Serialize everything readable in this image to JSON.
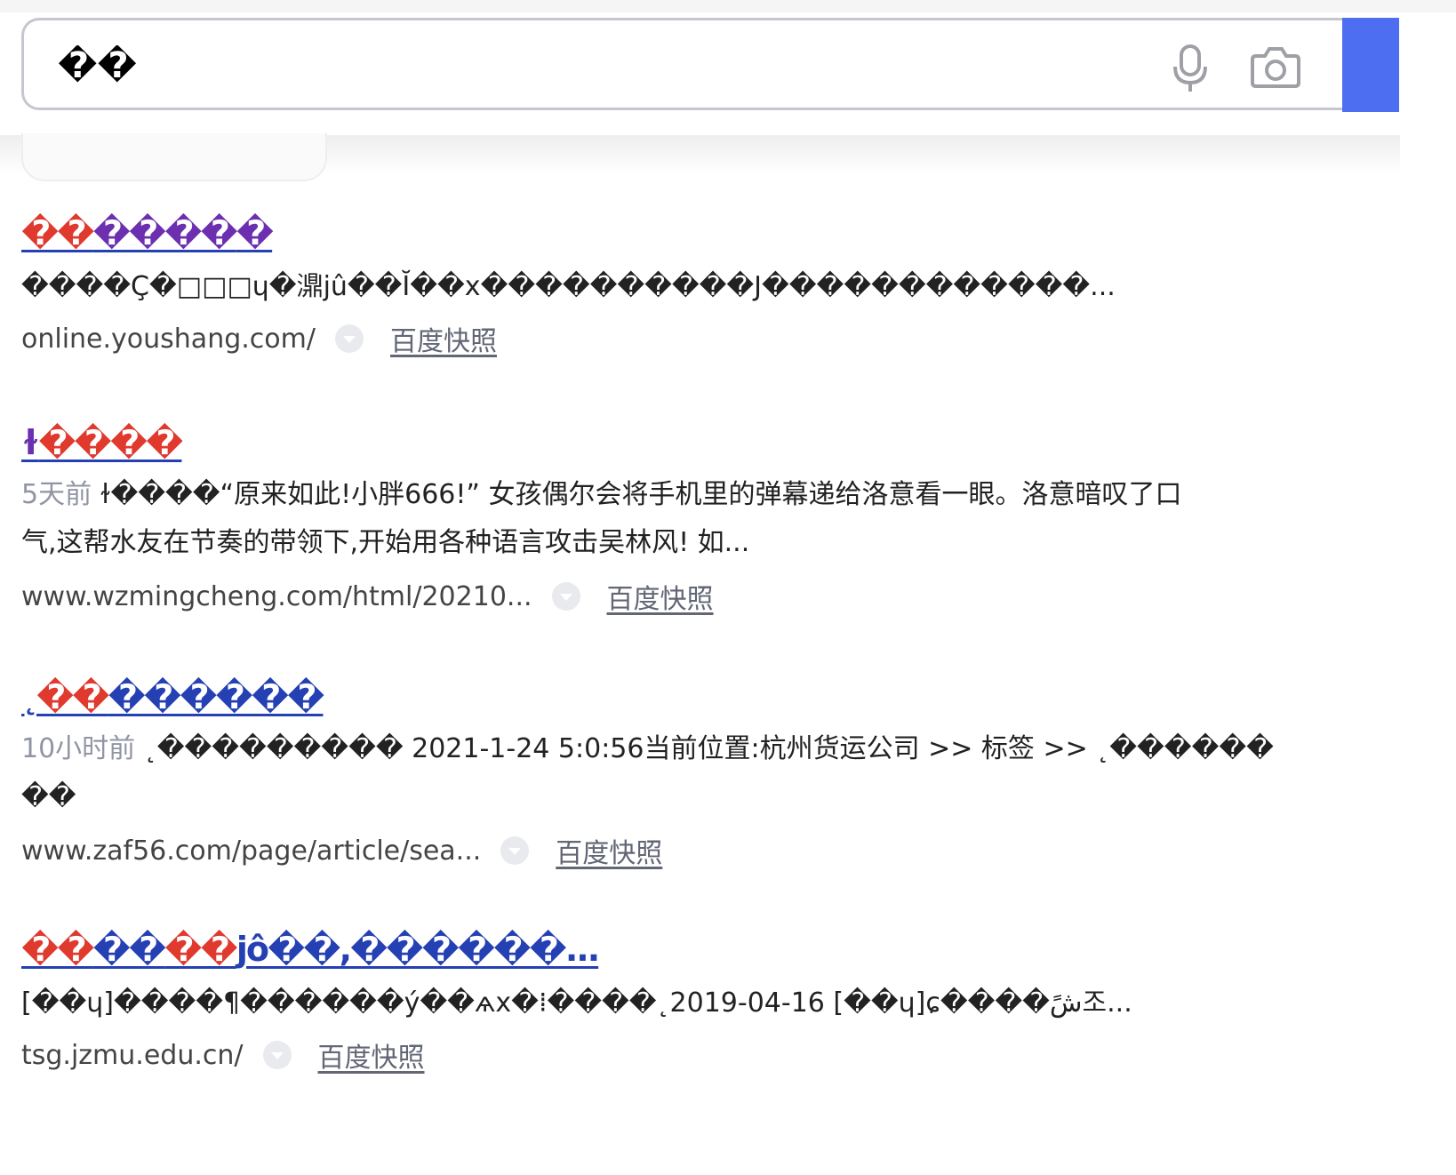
{
  "search": {
    "query": "��",
    "button_label": ""
  },
  "colors": {
    "accent": "#4e6ef2",
    "title_blue": "#2440b3",
    "highlight_red": "#e0392e",
    "visited_purple": "#6b2fb0",
    "date_gray": "#9195a3"
  },
  "icons": {
    "voice": "microphone-icon",
    "image_search": "camera-icon",
    "more": "chevron-down-circle-icon"
  },
  "results": [
    {
      "title_parts": [
        {
          "text": "��",
          "color": "red"
        },
        {
          "text": "����",
          "color": "purple"
        },
        {
          "text": "�",
          "color": "purple"
        }
      ],
      "date": "",
      "abstract": "����Ç�□□□ɥ�濎jû��Ĭ��x����������Ϳ������������...",
      "url": "online.youshang.com/",
      "snapshot": "百度快照"
    },
    {
      "title_parts": [
        {
          "text": "ɫ",
          "color": "purple"
        },
        {
          "text": "����",
          "color": "red"
        }
      ],
      "date": "5天前",
      "abstract_line1": "ɫ����“原来如此!小胖666!” 女孩偶尔会将手机里的弹幕递给洛意看一眼。洛意暗叹了口",
      "abstract_line2": "气,这帮水友在节奏的带领下,开始用各种语言攻击吴林风! 如...",
      "url": "www.wzmingcheng.com/html/20210...",
      "snapshot": "百度快照"
    },
    {
      "title_parts": [
        {
          "text": "˛",
          "color": "blue"
        },
        {
          "text": "��",
          "color": "red"
        },
        {
          "text": "������",
          "color": "blue"
        }
      ],
      "date": "10小时前",
      "abstract_line1": "˛��������� 2021-1-24 5:0:56当前位置:杭州货运公司 >> 标签 >> ˛������",
      "abstract_line2": "��",
      "url": "www.zaf56.com/page/article/sea...",
      "snapshot": "百度快照"
    },
    {
      "title_parts": [
        {
          "text": "��",
          "color": "red"
        },
        {
          "text": "��",
          "color": "blue"
        },
        {
          "text": "��",
          "color": "red"
        },
        {
          "text": "jô��,������...",
          "color": "blue"
        }
      ],
      "date": "",
      "abstract": "[��ɥ]����¶������ý��ѧх�⁞����˛2019-04-16 [��ɥ]ɕ����شً조...",
      "url": "tsg.jzmu.edu.cn/",
      "snapshot": "百度快照"
    }
  ]
}
